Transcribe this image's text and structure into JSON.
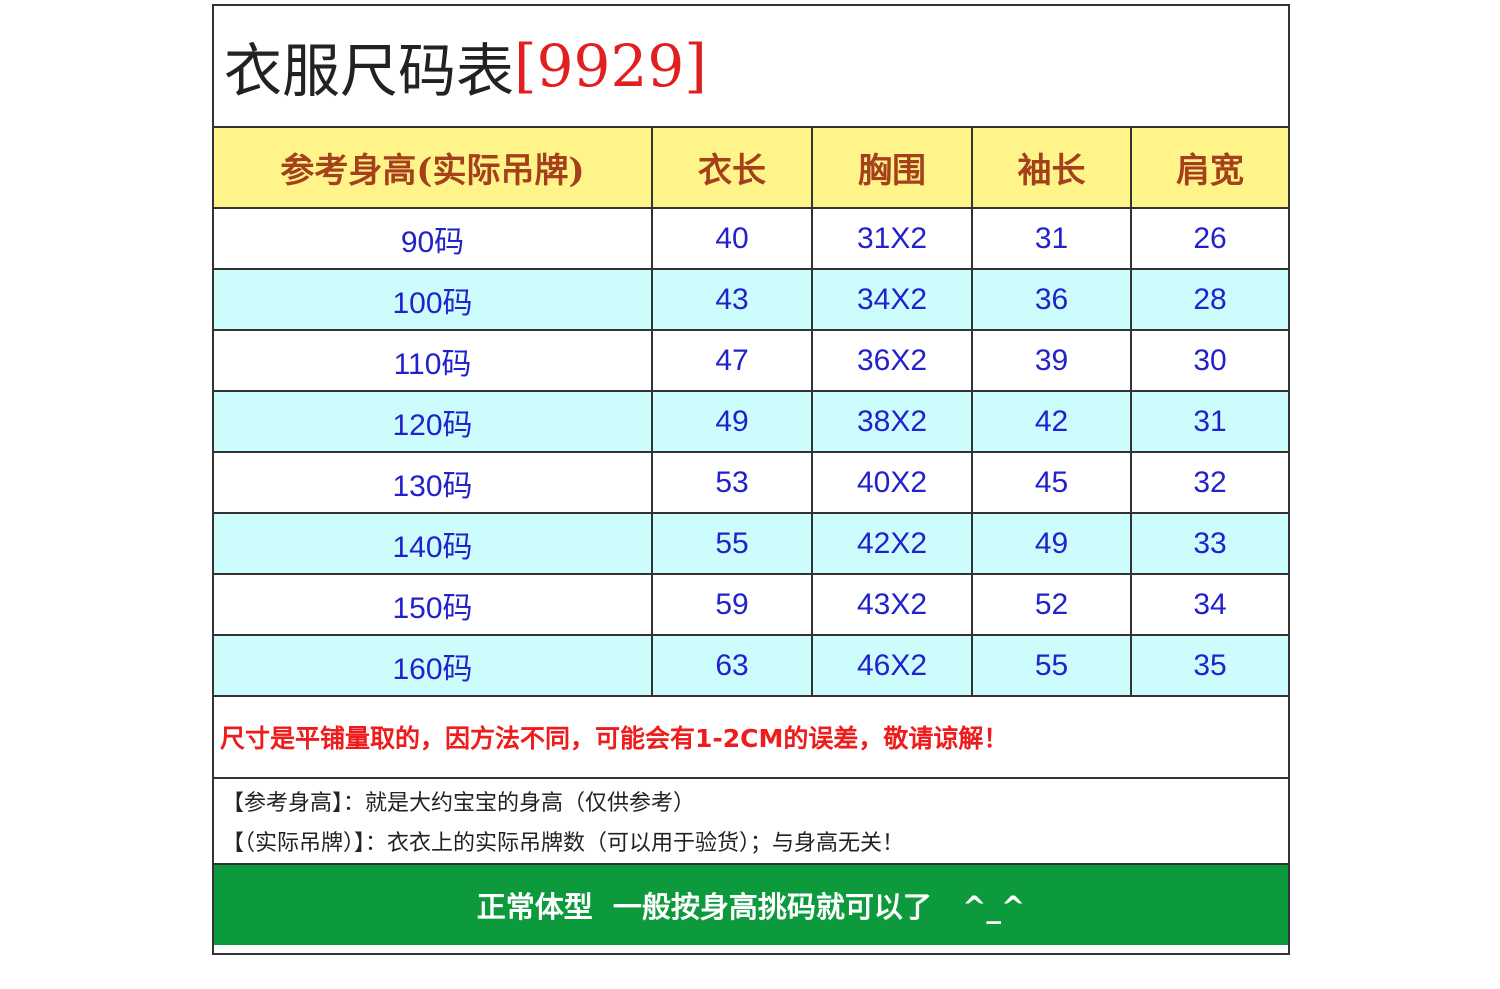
{
  "title": {
    "text": "衣服尺码表",
    "code": "[9929]"
  },
  "table": {
    "headers": [
      "参考身高(实际吊牌)",
      "衣长",
      "胸围",
      "袖长",
      "肩宽"
    ],
    "rows": [
      [
        "90码",
        "40",
        "31X2",
        "31",
        "26"
      ],
      [
        "100码",
        "43",
        "34X2",
        "36",
        "28"
      ],
      [
        "110码",
        "47",
        "36X2",
        "39",
        "30"
      ],
      [
        "120码",
        "49",
        "38X2",
        "42",
        "31"
      ],
      [
        "130码",
        "53",
        "40X2",
        "45",
        "32"
      ],
      [
        "140码",
        "55",
        "42X2",
        "49",
        "33"
      ],
      [
        "150码",
        "59",
        "43X2",
        "52",
        "34"
      ],
      [
        "160码",
        "63",
        "46X2",
        "55",
        "35"
      ]
    ]
  },
  "note_red": "尺寸是平铺量取的，因方法不同，可能会有1-2CM的误差，敬请谅解！",
  "notes": [
    "【参考身高】：就是大约宝宝的身高（仅供参考）",
    "【（实际吊牌）】：衣衣上的实际吊牌数（可以用于验货）；与身高无关！"
  ],
  "footer": "正常体型  一般按身高挑码就可以了   ^_^",
  "colors": {
    "header_bg": "#fef48a",
    "header_text": "#a5401c",
    "row_alt_bg": "#ccfcfc",
    "cell_text": "#2222cc",
    "warning_text": "#ee1c1c",
    "footer_bg": "#0d9a3c"
  }
}
